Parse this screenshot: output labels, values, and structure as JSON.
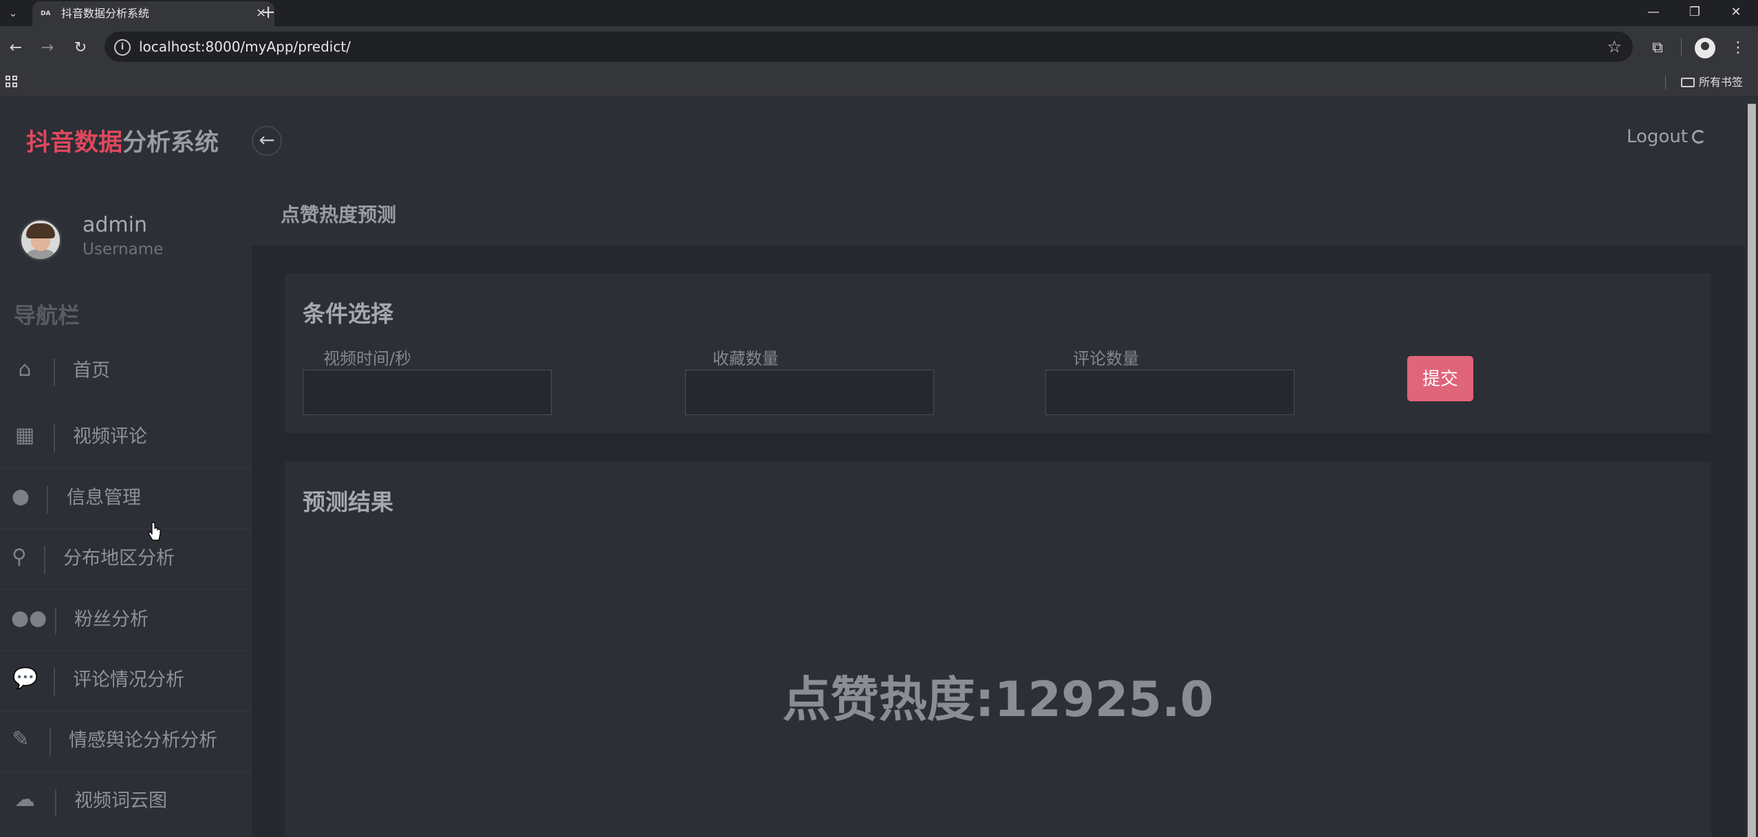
{
  "browser": {
    "tab_title": "抖音数据分析系统",
    "favicon_text": "DA",
    "url": "localhost:8000/myApp/predict/",
    "bookmarks_folder": "所有书签"
  },
  "header": {
    "brand_highlight": "抖音数据",
    "brand_rest": "分析系统",
    "logout_label": "Logout"
  },
  "user": {
    "name": "admin",
    "role": "Username"
  },
  "sidebar": {
    "title": "导航栏",
    "items": [
      {
        "label": "首页",
        "icon": "home-icon"
      },
      {
        "label": "视频评论",
        "icon": "grid-icon"
      },
      {
        "label": "信息管理",
        "icon": "user-icon"
      },
      {
        "label": "分布地区分析",
        "icon": "map-marker-icon"
      },
      {
        "label": "粉丝分析",
        "icon": "users-icon"
      },
      {
        "label": "评论情况分析",
        "icon": "comment-icon"
      },
      {
        "label": "情感舆论分析分析",
        "icon": "fire-icon"
      },
      {
        "label": "视频词云图",
        "icon": "cloud-download-icon"
      }
    ]
  },
  "page": {
    "title": "点赞热度预测"
  },
  "conditions": {
    "title": "条件选择",
    "fields": [
      {
        "label": "视频时间/秒",
        "value": ""
      },
      {
        "label": "收藏数量",
        "value": ""
      },
      {
        "label": "评论数量",
        "value": ""
      }
    ],
    "submit_label": "提交"
  },
  "result": {
    "title": "预测结果",
    "text": "点赞热度:12925.0"
  },
  "colors": {
    "brand_red": "#e0485e",
    "submit_button": "#e0647a"
  }
}
